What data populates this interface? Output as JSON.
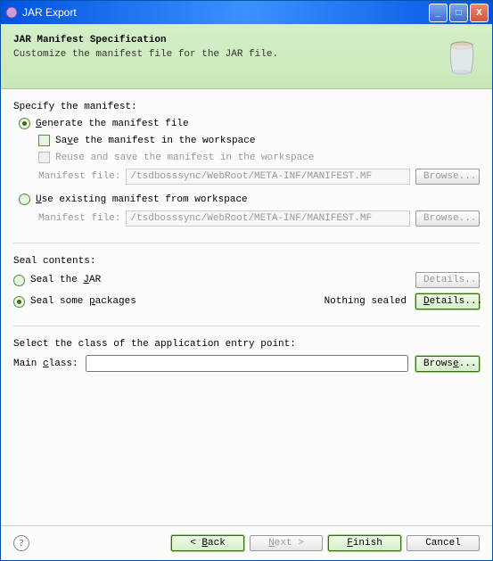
{
  "window": {
    "title": "JAR Export"
  },
  "header": {
    "title": "JAR Manifest Specification",
    "subtitle": "Customize the manifest file for the JAR file."
  },
  "manifest": {
    "section_label": "Specify the manifest:",
    "generate_label": "Generate the manifest file",
    "save_label": "Save the manifest in the workspace",
    "reuse_label": "Reuse and save the manifest in the workspace",
    "use_existing_label": "Use existing manifest from workspace",
    "file_label": "Manifest file:",
    "file_value": "/tsdbosssync/WebRoot/META-INF/MANIFEST.MF",
    "browse_label": "Browse..."
  },
  "seal": {
    "section_label": "Seal contents:",
    "seal_jar_label": "Seal the JAR",
    "seal_some_label": "Seal some packages",
    "nothing_sealed": "Nothing sealed",
    "details_label": "Details..."
  },
  "entry": {
    "section_label": "Select the class of the application entry point:",
    "main_class_label": "Main class:",
    "main_class_value": "",
    "browse_label": "Browse..."
  },
  "buttons": {
    "back": "< Back",
    "next": "Next >",
    "finish": "Finish",
    "cancel": "Cancel",
    "help": "?"
  },
  "winctl": {
    "min": "_",
    "max": "□",
    "close": "X"
  }
}
